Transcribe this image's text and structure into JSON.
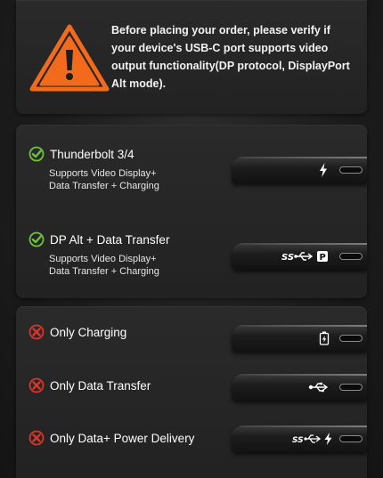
{
  "warning": {
    "line1": "Before placing your order, please verify if",
    "line2": "your device's USB-C port supports video",
    "line3": "output functionality(DP protocol, DisplayPort",
    "line4": "Alt mode).",
    "icon": "warning-triangle-icon",
    "color": "#f26a1b"
  },
  "supported": [
    {
      "title": "Thunderbolt 3/4",
      "desc_line1": "Supports Video Display+",
      "desc_line2": "Data Transfer + Charging",
      "status_icon": "check-circle-icon",
      "port_icon": "thunderbolt-icon"
    },
    {
      "title": "DP Alt + Data Transfer",
      "desc_line1": "Supports Video Display+",
      "desc_line2": "Data Transfer + Charging",
      "status_icon": "check-circle-icon",
      "port_icon": "ss-usb-displayport-icon"
    }
  ],
  "unsupported": [
    {
      "title": "Only Charging",
      "status_icon": "x-circle-icon",
      "port_icon": "battery-charging-icon"
    },
    {
      "title": "Only Data Transfer",
      "status_icon": "x-circle-icon",
      "port_icon": "usb-icon"
    },
    {
      "title": "Only Data+ Power Delivery",
      "status_icon": "x-circle-icon",
      "port_icon": "ss-usb-power-delivery-icon"
    }
  ],
  "colors": {
    "check": "#6fc23a",
    "cross": "#d8342a",
    "warning": "#f26a1b"
  }
}
